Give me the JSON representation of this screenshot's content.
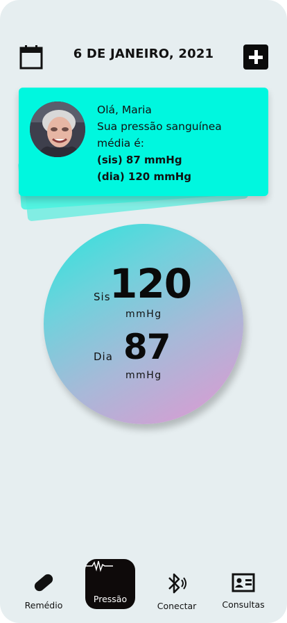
{
  "header": {
    "date": "6 DE JANEIRO, 2021",
    "calendar_icon": "calendar-icon",
    "add_icon": "plus-icon"
  },
  "summary_card": {
    "greeting": "Olá, Maria",
    "line1": "Sua pressão sanguínea",
    "line2": "média é:",
    "sis_line": "(sis) 87 mmHg",
    "dia_line": "(dia) 120 mmHg"
  },
  "reading": {
    "sis_label": "Sis",
    "sis_value": "120",
    "sis_unit": "mmHg",
    "dia_label": "Dia",
    "dia_value": "87",
    "dia_unit": "mmHg"
  },
  "nav": {
    "items": [
      {
        "label": "Remédio",
        "icon": "pill-icon"
      },
      {
        "label": "Pressão",
        "icon": "heartbeat-icon"
      },
      {
        "label": "Conectar",
        "icon": "bluetooth-icon"
      },
      {
        "label": "Consultas",
        "icon": "id-card-icon"
      }
    ]
  },
  "colors": {
    "card": "#00f7df",
    "background": "#e6eef0",
    "gradient_start": "#2de3dc",
    "gradient_end": "#e197d1",
    "active_nav": "#0e0a0a"
  }
}
